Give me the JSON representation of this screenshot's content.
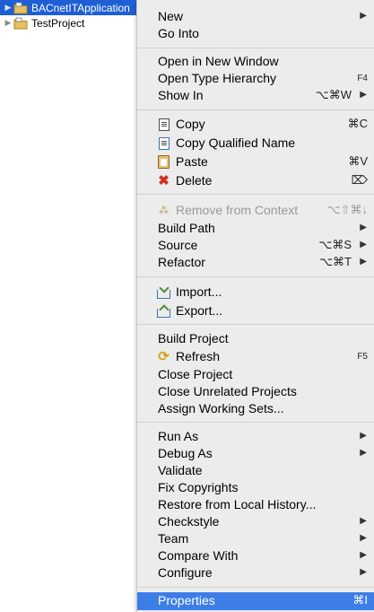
{
  "tree": {
    "items": [
      {
        "label": "BACnetITApplication",
        "selected": true,
        "icon": "project-folder-icon"
      },
      {
        "label": "TestProject",
        "selected": false,
        "icon": "project-folder-icon"
      }
    ]
  },
  "context_menu": {
    "groups": [
      {
        "items": [
          {
            "label": "New",
            "shortcut": "",
            "submenu": true
          },
          {
            "label": "Go Into",
            "shortcut": "",
            "submenu": false
          }
        ]
      },
      {
        "items": [
          {
            "label": "Open in New Window",
            "shortcut": "",
            "submenu": false
          },
          {
            "label": "Open Type Hierarchy",
            "shortcut": "F4",
            "submenu": false
          },
          {
            "label": "Show In",
            "shortcut": "⌥⌘W",
            "submenu": true
          }
        ]
      },
      {
        "items": [
          {
            "label": "Copy",
            "shortcut": "⌘C",
            "icon": "copy-icon"
          },
          {
            "label": "Copy Qualified Name",
            "shortcut": "",
            "icon": "copy-qualified-name-icon"
          },
          {
            "label": "Paste",
            "shortcut": "⌘V",
            "icon": "paste-icon"
          },
          {
            "label": "Delete",
            "shortcut": "⌦",
            "icon": "delete-icon"
          }
        ]
      },
      {
        "items": [
          {
            "label": "Remove from Context",
            "shortcut": "⌥⇧⌘↓",
            "icon": "remove-from-context-icon",
            "disabled": true
          },
          {
            "label": "Build Path",
            "shortcut": "",
            "submenu": true
          },
          {
            "label": "Source",
            "shortcut": "⌥⌘S",
            "submenu": true
          },
          {
            "label": "Refactor",
            "shortcut": "⌥⌘T",
            "submenu": true
          }
        ]
      },
      {
        "items": [
          {
            "label": "Import...",
            "icon": "import-icon"
          },
          {
            "label": "Export...",
            "icon": "export-icon"
          }
        ]
      },
      {
        "items": [
          {
            "label": "Build Project"
          },
          {
            "label": "Refresh",
            "shortcut": "F5",
            "icon": "refresh-icon"
          },
          {
            "label": "Close Project"
          },
          {
            "label": "Close Unrelated Projects"
          },
          {
            "label": "Assign Working Sets..."
          }
        ]
      },
      {
        "items": [
          {
            "label": "Run As",
            "submenu": true
          },
          {
            "label": "Debug As",
            "submenu": true
          },
          {
            "label": "Validate"
          },
          {
            "label": "Fix Copyrights"
          },
          {
            "label": "Restore from Local History..."
          },
          {
            "label": "Checkstyle",
            "submenu": true
          },
          {
            "label": "Team",
            "submenu": true
          },
          {
            "label": "Compare With",
            "submenu": true
          },
          {
            "label": "Configure",
            "submenu": true
          }
        ]
      },
      {
        "items": [
          {
            "label": "Properties",
            "shortcut": "⌘I",
            "highlighted": true
          }
        ]
      }
    ]
  },
  "colors": {
    "menu_background": "#ececec",
    "highlight": "#3d7ee6",
    "tree_selection": "#1f5fd3"
  }
}
